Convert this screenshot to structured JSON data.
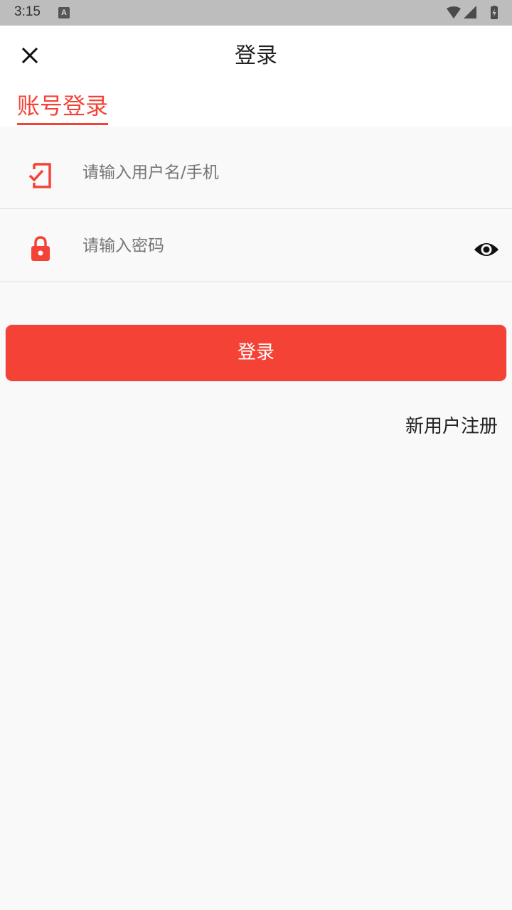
{
  "status_bar": {
    "time": "3:15",
    "notification_letter": "A",
    "icons": [
      "wifi-icon",
      "signal-icon",
      "battery-charging-icon"
    ]
  },
  "header": {
    "title": "登录",
    "close_icon": "close-icon",
    "tab_label": "账号登录",
    "accent_color": "#f44336"
  },
  "form": {
    "username": {
      "value": "",
      "placeholder": "请输入用户名/手机",
      "icon": "phone-check-icon"
    },
    "password": {
      "value": "",
      "placeholder": "请输入密码",
      "icon": "lock-icon",
      "toggle_icon": "eye-icon"
    },
    "login_button_label": "登录",
    "register_link_label": "新用户注册"
  }
}
